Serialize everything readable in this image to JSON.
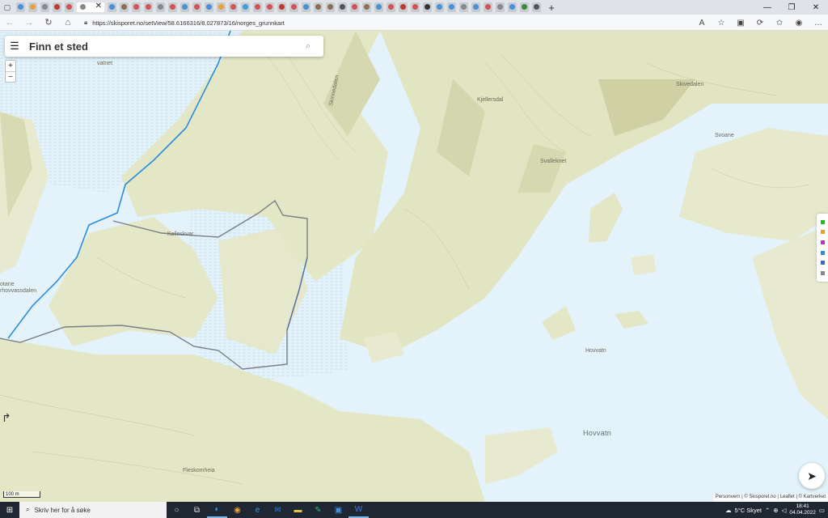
{
  "browser": {
    "url": "https://skisporet.no/setView/58.6166316/8.027873/16/norges_grunnkart",
    "tab_count": 42,
    "close_tab_glyph": "✕",
    "new_tab_glyph": "+",
    "window_controls": [
      "—",
      "❐",
      "✕"
    ],
    "tab_colors": [
      "#4a90d9",
      "#e6a23c",
      "#888",
      "#c0392b",
      "#d35454",
      "#888",
      "#4a90d9",
      "#8e6e53",
      "#d35454",
      "#d35454",
      "#888",
      "#d35454",
      "#4a90d9",
      "#d35454",
      "#4a90d9",
      "#e6a23c",
      "#d35454",
      "#3aa0d6",
      "#d35454",
      "#d35454",
      "#c0392b",
      "#d35454",
      "#4a90d9",
      "#8e6e53",
      "#8e6e53",
      "#555",
      "#d35454",
      "#8e6e53",
      "#4a90d9",
      "#d35454",
      "#c0392b",
      "#d35454",
      "#333",
      "#4a90d9",
      "#4a90d9",
      "#888",
      "#4a90d9",
      "#d35454",
      "#888",
      "#4a90d9",
      "#3a8a3a",
      "#555"
    ]
  },
  "map": {
    "search_placeholder": "Finn et sted",
    "zoom_in": "+",
    "zoom_out": "−",
    "scale_label": "100 m",
    "attribution": "Personvern | © Skisporet.no | Leaflet | © Kartverket",
    "layer_colors": [
      "#18c418",
      "#f0a020",
      "#c030c0",
      "#2090e0",
      "#3070c0",
      "#888888"
    ],
    "places": {
      "vatnet": "vatnet",
      "kalleskvar": "Kalleskvar",
      "skinnedalen": "Skinnedalen",
      "kjellersdal": "Kjellersdal",
      "skivedalen": "Skivedalen",
      "svoane": "Svoane",
      "svalleknet": "Svalleknet",
      "hovvatn_small": "Hovvatn",
      "hovvatn_big": "Hovvatn",
      "fleskomheia": "Fleskomheia",
      "lofthovvassdalen_1": "otane",
      "lofthovvassdalen_2": "rhovvassdalen"
    }
  },
  "taskbar": {
    "search_placeholder": "Skriv her for å søke",
    "weather": "5°C  Skyet",
    "time": "18:41",
    "date": "04.04.2022"
  }
}
